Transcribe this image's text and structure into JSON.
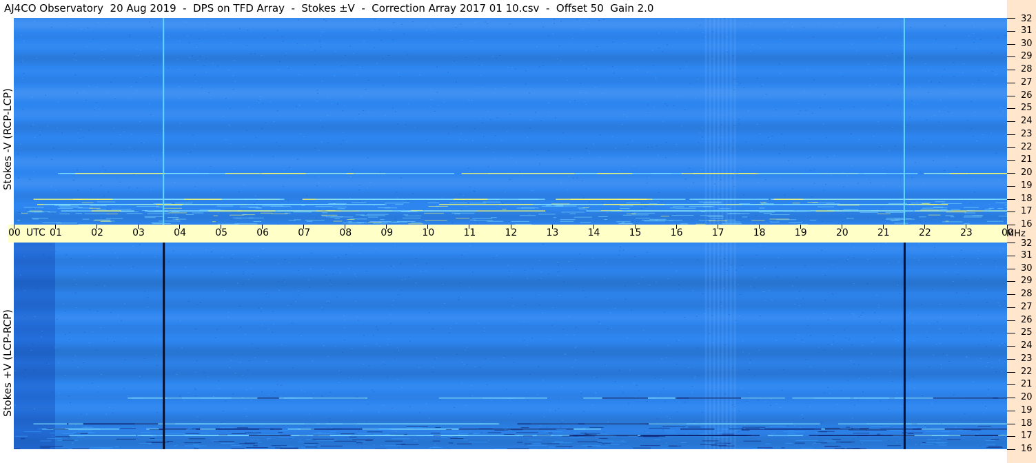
{
  "title": "AJ4CO Observatory  20 Aug 2019  -  DPS on TFD Array  -  Stokes ±V  -  Correction Array 2017 01 10.csv  -  Offset 50  Gain 2.0",
  "chart_data": [
    {
      "type": "heatmap",
      "name": "Stokes -V (RCP-LCP)",
      "ylabel": "Stokes -V (RCP-LCP)",
      "x_ticks": [
        "00",
        "UTC",
        "01",
        "02",
        "03",
        "04",
        "05",
        "06",
        "07",
        "08",
        "09",
        "10",
        "11",
        "12",
        "13",
        "14",
        "15",
        "16",
        "17",
        "18",
        "19",
        "20",
        "21",
        "22",
        "23",
        "00"
      ],
      "x_unit": "UTC",
      "y_ticks": [
        32,
        31,
        30,
        29,
        28,
        27,
        26,
        25,
        24,
        23,
        22,
        21,
        20,
        19,
        18,
        17,
        16
      ],
      "y_unit": "MHz",
      "ylim": [
        16,
        32
      ],
      "xlim": [
        0,
        24
      ],
      "colormap": [
        "#0a1a66",
        "#1f5fd6",
        "#2e86f0",
        "#3aa0ff",
        "#7fe0ff",
        "#ffff66"
      ],
      "features": {
        "vertical_lines_utc": [
          3.6,
          21.5
        ],
        "interference_bands_mhz": [
          17.1,
          17.6,
          18.0,
          20.0
        ],
        "stripe_utc_range": [
          16.7,
          17.4
        ]
      }
    },
    {
      "type": "heatmap",
      "name": "Stokes +V (LCP-RCP)",
      "ylabel": "Stokes +V (LCP-RCP)",
      "x_ticks": [
        "00",
        "UTC",
        "01",
        "02",
        "03",
        "04",
        "05",
        "06",
        "07",
        "08",
        "09",
        "10",
        "11",
        "12",
        "13",
        "14",
        "15",
        "16",
        "17",
        "18",
        "19",
        "20",
        "21",
        "22",
        "23",
        "00"
      ],
      "x_unit": "UTC",
      "y_ticks": [
        32,
        31,
        30,
        29,
        28,
        27,
        26,
        25,
        24,
        23,
        22,
        21,
        20,
        19,
        18,
        17,
        16
      ],
      "y_unit": "MHz",
      "ylim": [
        16,
        32
      ],
      "xlim": [
        0,
        24
      ],
      "colormap": [
        "#0a1a66",
        "#1f5fd6",
        "#2e86f0",
        "#3aa0ff",
        "#7fe0ff",
        "#ffff66"
      ],
      "features": {
        "vertical_lines_utc": [
          3.6,
          21.5
        ],
        "interference_bands_mhz": [
          17.1,
          17.6,
          18.0,
          20.0
        ],
        "stripe_utc_range": [
          16.7,
          17.4
        ]
      }
    }
  ],
  "time_axis": {
    "labels": [
      "00",
      "UTC",
      "01",
      "02",
      "03",
      "04",
      "05",
      "06",
      "07",
      "08",
      "09",
      "10",
      "11",
      "12",
      "13",
      "14",
      "15",
      "16",
      "17",
      "18",
      "19",
      "20",
      "21",
      "22",
      "23",
      "00"
    ],
    "unit_label": "MHz"
  },
  "freq_axis": {
    "labels": [
      "32",
      "31",
      "30",
      "29",
      "28",
      "27",
      "26",
      "25",
      "24",
      "23",
      "22",
      "21",
      "20",
      "19",
      "18",
      "17",
      "16"
    ]
  },
  "colors": {
    "axis_band": "#ffffc8",
    "right_strip": "#ffe6cc",
    "base_blue": "#2e86f0"
  }
}
